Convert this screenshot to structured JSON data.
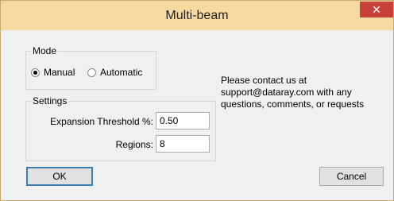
{
  "window": {
    "title": "Multi-beam",
    "close_glyph": "✕"
  },
  "mode": {
    "label": "Mode",
    "options": [
      {
        "label": "Manual",
        "selected": true
      },
      {
        "label": "Automatic",
        "selected": false
      }
    ]
  },
  "settings": {
    "label": "Settings",
    "expansion_threshold": {
      "label": "Expansion Threshold %:",
      "value": "0.50"
    },
    "regions": {
      "label": "Regions:",
      "value": "8"
    }
  },
  "info": {
    "line1": "Please contact us at",
    "line2": "support@dataray.com with any",
    "line3": "questions, comments, or requests"
  },
  "buttons": {
    "ok": "OK",
    "cancel": "Cancel"
  },
  "colors": {
    "titlebar": "#f5d9a0",
    "close_button": "#c7403a",
    "dialog_background": "#f0f0f0"
  }
}
